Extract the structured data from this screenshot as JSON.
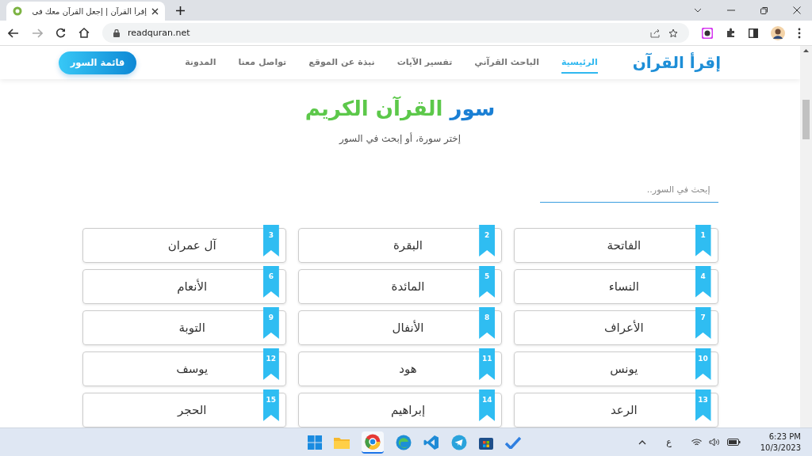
{
  "browser": {
    "tab_title": "إقرأ القرآن | إجعل القرآن معك في",
    "url": "readquran.net"
  },
  "nav": {
    "logo": "إقرأ القرآن",
    "links": [
      {
        "label": "الرئيسية",
        "selected": true
      },
      {
        "label": "الباحث القرآني",
        "selected": false
      },
      {
        "label": "تفسير الآيات",
        "selected": false
      },
      {
        "label": "نبذة عن الموقع",
        "selected": false
      },
      {
        "label": "تواصل معنا",
        "selected": false
      },
      {
        "label": "المدونة",
        "selected": false
      }
    ],
    "cta": "قائمة السور"
  },
  "hero": {
    "title_prefix": "سور",
    "title_rest": "القرآن الكريم",
    "subtitle": "إختر سورة، أو إبحث في السور"
  },
  "search": {
    "placeholder": "إبحث في السور.."
  },
  "surahs": [
    {
      "number": "1",
      "name": "الفاتحة"
    },
    {
      "number": "2",
      "name": "البقرة"
    },
    {
      "number": "3",
      "name": "آل عمران"
    },
    {
      "number": "4",
      "name": "النساء"
    },
    {
      "number": "5",
      "name": "المائدة"
    },
    {
      "number": "6",
      "name": "الأنعام"
    },
    {
      "number": "7",
      "name": "الأعراف"
    },
    {
      "number": "8",
      "name": "الأنفال"
    },
    {
      "number": "9",
      "name": "التوبة"
    },
    {
      "number": "10",
      "name": "يونس"
    },
    {
      "number": "11",
      "name": "هود"
    },
    {
      "number": "12",
      "name": "يوسف"
    },
    {
      "number": "13",
      "name": "الرعد"
    },
    {
      "number": "14",
      "name": "إبراهيم"
    },
    {
      "number": "15",
      "name": "الحجر"
    }
  ],
  "taskbar": {
    "language": "ع",
    "time": "6:23 PM",
    "date": "10/3/2023"
  }
}
